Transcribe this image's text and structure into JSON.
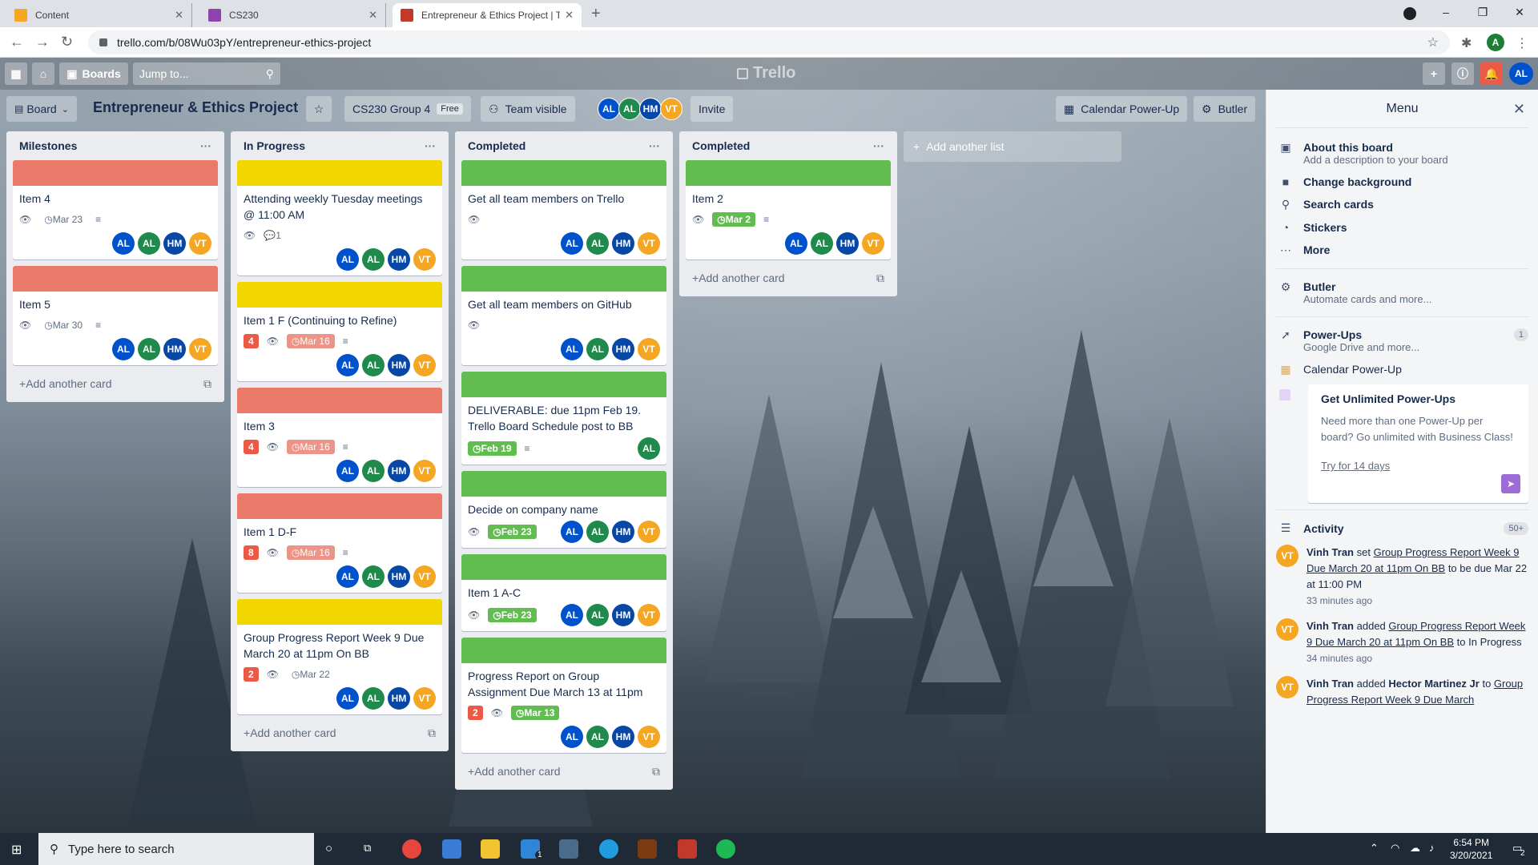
{
  "browser": {
    "tabs": [
      {
        "label": "Content",
        "fav_color": "#f5a623"
      },
      {
        "label": "CS230",
        "fav_color": "#8e44ad"
      },
      {
        "label": "Entrepreneur & Ethics Project | Tr",
        "fav_color": "#c0392b"
      }
    ],
    "url": "trello.com/b/08Wu03pY/entrepreneur-ethics-project",
    "account_initial": "A"
  },
  "header": {
    "boards_label": "Boards",
    "jump_placeholder": "Jump to...",
    "logo": "Trello",
    "user_initials": "AL"
  },
  "board": {
    "view_label": "Board",
    "title": "Entrepreneur & Ethics Project",
    "team_label": "CS230 Group 4",
    "free_badge": "Free",
    "visibility_label": "Team visible",
    "members": [
      "AL",
      "AL",
      "HM",
      "VT"
    ],
    "invite_label": "Invite",
    "calendar_label": "Calendar Power-Up",
    "butler_label": "Butler"
  },
  "lists": [
    {
      "title": "Milestones",
      "add_label": "Add another card",
      "cards": [
        {
          "cover": "#eb7a6a",
          "title": "Item 4",
          "due": "Mar 23",
          "due_style": "plain",
          "has_desc": true,
          "members": [
            "AL",
            "AL",
            "HM",
            "VT"
          ]
        },
        {
          "cover": "#eb7a6a",
          "title": "Item 5",
          "due": "Mar 30",
          "due_style": "plain",
          "has_desc": true,
          "members": [
            "AL",
            "AL",
            "HM",
            "VT"
          ]
        }
      ]
    },
    {
      "title": "In Progress",
      "add_label": "Add another card",
      "cards": [
        {
          "cover": "#f2d600",
          "title": "Attending weekly Tuesday meetings @ 11:00 AM",
          "comments": "1",
          "members": [
            "AL",
            "AL",
            "HM",
            "VT"
          ]
        },
        {
          "cover": "#f2d600",
          "title": "Item 1 F (Continuing to Refine)",
          "notif": "4",
          "due": "Mar 16",
          "due_style": "red",
          "has_desc": true,
          "members": [
            "AL",
            "AL",
            "HM",
            "VT"
          ]
        },
        {
          "cover": "#eb7a6a",
          "title": "Item 3",
          "notif": "4",
          "due": "Mar 16",
          "due_style": "red",
          "has_desc": true,
          "members": [
            "AL",
            "AL",
            "HM",
            "VT"
          ]
        },
        {
          "cover": "#eb7a6a",
          "title": "Item 1 D-F",
          "notif": "8",
          "due": "Mar 16",
          "due_style": "red",
          "has_desc": true,
          "members": [
            "AL",
            "AL",
            "HM",
            "VT"
          ]
        },
        {
          "cover": "#f2d600",
          "title": "Group Progress Report Week 9 Due March 20 at 11pm On BB",
          "notif": "2",
          "due": "Mar 22",
          "due_style": "plain",
          "members": [
            "AL",
            "AL",
            "HM",
            "VT"
          ]
        }
      ]
    },
    {
      "title": "Completed",
      "add_label": "Add another card",
      "cards": [
        {
          "cover": "#61bd4f",
          "title": "Get all team members on Trello",
          "members": [
            "AL",
            "AL",
            "HM",
            "VT"
          ]
        },
        {
          "cover": "#61bd4f",
          "title": "Get all team members on GitHub",
          "members": [
            "AL",
            "AL",
            "HM",
            "VT"
          ]
        },
        {
          "cover": "#61bd4f",
          "title": "DELIVERABLE: due 11pm Feb 19. Trello Board Schedule post to BB",
          "due": "Feb 19",
          "due_style": "ok",
          "no_eye": true,
          "has_desc": true,
          "members": [
            "AL"
          ],
          "inline_members": true
        },
        {
          "cover": "#61bd4f",
          "title": "Decide on company name",
          "due": "Feb 23",
          "due_style": "ok",
          "members": [
            "AL",
            "AL",
            "HM",
            "VT"
          ],
          "inline_members": true
        },
        {
          "cover": "#61bd4f",
          "title": "Item 1 A-C",
          "due": "Feb 23",
          "due_style": "ok",
          "members": [
            "AL",
            "AL",
            "HM",
            "VT"
          ],
          "inline_members": true
        },
        {
          "cover": "#61bd4f",
          "title": "Progress Report on Group Assignment Due March 13 at 11pm",
          "notif": "2",
          "due": "Mar 13",
          "due_style": "ok",
          "members": [
            "AL",
            "AL",
            "HM",
            "VT"
          ]
        }
      ]
    },
    {
      "title": "Completed",
      "add_label": "Add another card",
      "cards": [
        {
          "cover": "#61bd4f",
          "title": "Item 2",
          "due": "Mar 2",
          "due_style": "ok",
          "has_desc": true,
          "members": [
            "AL",
            "AL",
            "HM",
            "VT"
          ]
        }
      ]
    }
  ],
  "add_list_label": "Add another list",
  "menu": {
    "title": "Menu",
    "items": [
      {
        "icon": "board-icon",
        "glyph": "▣",
        "title": "About this board",
        "sub": "Add a description to your board"
      },
      {
        "icon": "background-icon",
        "glyph": "■",
        "title": "Change background",
        "sub": ""
      },
      {
        "icon": "search-icon",
        "glyph": "⚲",
        "title": "Search cards",
        "sub": ""
      },
      {
        "icon": "sticker-icon",
        "glyph": "◔",
        "title": "Stickers",
        "sub": ""
      },
      {
        "icon": "more-icon",
        "glyph": "⋯",
        "title": "More",
        "sub": ""
      }
    ],
    "butler": {
      "title": "Butler",
      "sub": "Automate cards and more..."
    },
    "powerups": {
      "title": "Power-Ups",
      "sub": "Google Drive and more...",
      "count": "1"
    },
    "calendar": "Calendar Power-Up",
    "upsell": {
      "title": "Get Unlimited Power-Ups",
      "body": "Need more than one Power-Up per board? Go unlimited with Business Class!",
      "link": "Try for 14 days"
    },
    "activity_title": "Activity",
    "activity_count": "50+",
    "activity": [
      {
        "user": "Vinh Tran",
        "verb": "set",
        "card": "Group Progress Report Week 9 Due March 20 at 11pm On BB",
        "rest": "to be due Mar 22 at 11:00 PM",
        "time": "33 minutes ago"
      },
      {
        "user": "Vinh Tran",
        "verb": "added",
        "card": "Group Progress Report Week 9 Due March 20 at 11pm On BB",
        "rest": "to In Progress",
        "time": "34 minutes ago"
      },
      {
        "user": "Vinh Tran",
        "verb": "added",
        "target": "Hector Martinez Jr",
        "mid": "to",
        "card": "Group Progress Report Week 9 Due March",
        "rest": "",
        "time": ""
      }
    ]
  },
  "taskbar": {
    "search_placeholder": "Type here to search",
    "time": "6:54 PM",
    "date": "3/20/2021",
    "mail_badge": "1",
    "notif_badge": "2"
  }
}
